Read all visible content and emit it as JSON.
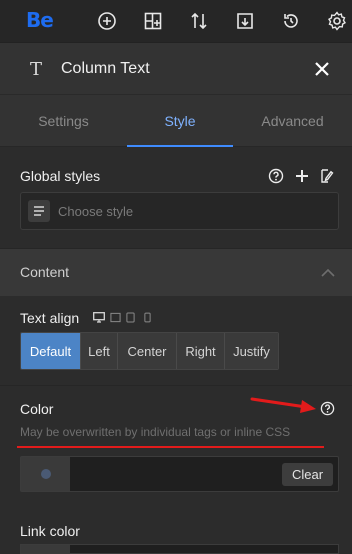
{
  "app": {
    "logo": "Be"
  },
  "panel": {
    "title": "Column Text"
  },
  "tabs": [
    {
      "label": "Settings",
      "active": false
    },
    {
      "label": "Style",
      "active": true
    },
    {
      "label": "Advanced",
      "active": false
    }
  ],
  "global_styles": {
    "label": "Global styles",
    "placeholder": "Choose style"
  },
  "content": {
    "label": "Content"
  },
  "text_align": {
    "label": "Text align",
    "options": [
      "Default",
      "Left",
      "Center",
      "Right",
      "Justify"
    ],
    "selected": "Default"
  },
  "color": {
    "label": "Color",
    "hint": "May be overwritten by individual tags or inline CSS",
    "clear_label": "Clear"
  },
  "link_color": {
    "label": "Link color"
  },
  "colors": {
    "accent": "#4c84c6",
    "tab_active": "#7fb2ff",
    "annotation": "#e21b1b"
  }
}
